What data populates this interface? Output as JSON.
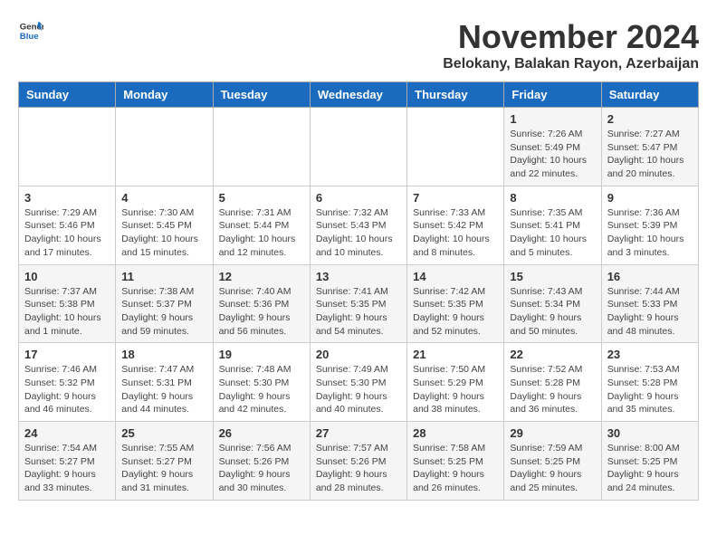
{
  "logo": {
    "text_general": "General",
    "text_blue": "Blue"
  },
  "header": {
    "month_year": "November 2024",
    "location": "Belokany, Balakan Rayon, Azerbaijan"
  },
  "weekdays": [
    "Sunday",
    "Monday",
    "Tuesday",
    "Wednesday",
    "Thursday",
    "Friday",
    "Saturday"
  ],
  "weeks": [
    [
      {
        "day": "",
        "info": ""
      },
      {
        "day": "",
        "info": ""
      },
      {
        "day": "",
        "info": ""
      },
      {
        "day": "",
        "info": ""
      },
      {
        "day": "",
        "info": ""
      },
      {
        "day": "1",
        "info": "Sunrise: 7:26 AM\nSunset: 5:49 PM\nDaylight: 10 hours and 22 minutes."
      },
      {
        "day": "2",
        "info": "Sunrise: 7:27 AM\nSunset: 5:47 PM\nDaylight: 10 hours and 20 minutes."
      }
    ],
    [
      {
        "day": "3",
        "info": "Sunrise: 7:29 AM\nSunset: 5:46 PM\nDaylight: 10 hours and 17 minutes."
      },
      {
        "day": "4",
        "info": "Sunrise: 7:30 AM\nSunset: 5:45 PM\nDaylight: 10 hours and 15 minutes."
      },
      {
        "day": "5",
        "info": "Sunrise: 7:31 AM\nSunset: 5:44 PM\nDaylight: 10 hours and 12 minutes."
      },
      {
        "day": "6",
        "info": "Sunrise: 7:32 AM\nSunset: 5:43 PM\nDaylight: 10 hours and 10 minutes."
      },
      {
        "day": "7",
        "info": "Sunrise: 7:33 AM\nSunset: 5:42 PM\nDaylight: 10 hours and 8 minutes."
      },
      {
        "day": "8",
        "info": "Sunrise: 7:35 AM\nSunset: 5:41 PM\nDaylight: 10 hours and 5 minutes."
      },
      {
        "day": "9",
        "info": "Sunrise: 7:36 AM\nSunset: 5:39 PM\nDaylight: 10 hours and 3 minutes."
      }
    ],
    [
      {
        "day": "10",
        "info": "Sunrise: 7:37 AM\nSunset: 5:38 PM\nDaylight: 10 hours and 1 minute."
      },
      {
        "day": "11",
        "info": "Sunrise: 7:38 AM\nSunset: 5:37 PM\nDaylight: 9 hours and 59 minutes."
      },
      {
        "day": "12",
        "info": "Sunrise: 7:40 AM\nSunset: 5:36 PM\nDaylight: 9 hours and 56 minutes."
      },
      {
        "day": "13",
        "info": "Sunrise: 7:41 AM\nSunset: 5:35 PM\nDaylight: 9 hours and 54 minutes."
      },
      {
        "day": "14",
        "info": "Sunrise: 7:42 AM\nSunset: 5:35 PM\nDaylight: 9 hours and 52 minutes."
      },
      {
        "day": "15",
        "info": "Sunrise: 7:43 AM\nSunset: 5:34 PM\nDaylight: 9 hours and 50 minutes."
      },
      {
        "day": "16",
        "info": "Sunrise: 7:44 AM\nSunset: 5:33 PM\nDaylight: 9 hours and 48 minutes."
      }
    ],
    [
      {
        "day": "17",
        "info": "Sunrise: 7:46 AM\nSunset: 5:32 PM\nDaylight: 9 hours and 46 minutes."
      },
      {
        "day": "18",
        "info": "Sunrise: 7:47 AM\nSunset: 5:31 PM\nDaylight: 9 hours and 44 minutes."
      },
      {
        "day": "19",
        "info": "Sunrise: 7:48 AM\nSunset: 5:30 PM\nDaylight: 9 hours and 42 minutes."
      },
      {
        "day": "20",
        "info": "Sunrise: 7:49 AM\nSunset: 5:30 PM\nDaylight: 9 hours and 40 minutes."
      },
      {
        "day": "21",
        "info": "Sunrise: 7:50 AM\nSunset: 5:29 PM\nDaylight: 9 hours and 38 minutes."
      },
      {
        "day": "22",
        "info": "Sunrise: 7:52 AM\nSunset: 5:28 PM\nDaylight: 9 hours and 36 minutes."
      },
      {
        "day": "23",
        "info": "Sunrise: 7:53 AM\nSunset: 5:28 PM\nDaylight: 9 hours and 35 minutes."
      }
    ],
    [
      {
        "day": "24",
        "info": "Sunrise: 7:54 AM\nSunset: 5:27 PM\nDaylight: 9 hours and 33 minutes."
      },
      {
        "day": "25",
        "info": "Sunrise: 7:55 AM\nSunset: 5:27 PM\nDaylight: 9 hours and 31 minutes."
      },
      {
        "day": "26",
        "info": "Sunrise: 7:56 AM\nSunset: 5:26 PM\nDaylight: 9 hours and 30 minutes."
      },
      {
        "day": "27",
        "info": "Sunrise: 7:57 AM\nSunset: 5:26 PM\nDaylight: 9 hours and 28 minutes."
      },
      {
        "day": "28",
        "info": "Sunrise: 7:58 AM\nSunset: 5:25 PM\nDaylight: 9 hours and 26 minutes."
      },
      {
        "day": "29",
        "info": "Sunrise: 7:59 AM\nSunset: 5:25 PM\nDaylight: 9 hours and 25 minutes."
      },
      {
        "day": "30",
        "info": "Sunrise: 8:00 AM\nSunset: 5:25 PM\nDaylight: 9 hours and 24 minutes."
      }
    ]
  ]
}
